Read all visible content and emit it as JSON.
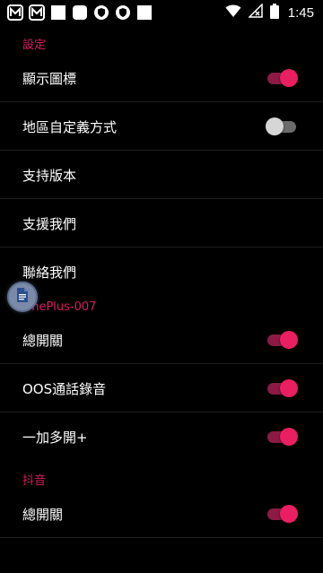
{
  "status_bar": {
    "time": "1:45",
    "left_icons": [
      "mx-app-icon",
      "mx-app-icon",
      "square-icon",
      "rounded-square-icon",
      "shield-icon",
      "shield-icon",
      "square-icon"
    ],
    "right_icons": [
      "wifi-icon",
      "signal-icon",
      "battery-icon"
    ]
  },
  "sections": [
    {
      "header": "設定",
      "items": [
        {
          "label": "顯示圖標",
          "switch": "on"
        },
        {
          "label": "地區自定義方式",
          "switch": "off"
        },
        {
          "label": "支持版本"
        },
        {
          "label": "支援我們"
        },
        {
          "label": "聯絡我們"
        }
      ]
    },
    {
      "header": "OnePlus-007",
      "items": [
        {
          "label": "總開關",
          "switch": "on"
        },
        {
          "label": "OOS通話錄音",
          "switch": "on"
        },
        {
          "label": "一加多開+",
          "switch": "on"
        }
      ]
    },
    {
      "header": "抖音",
      "items": [
        {
          "label": "總開關",
          "switch": "on"
        }
      ]
    }
  ],
  "floating_button": {
    "icon": "document-icon"
  },
  "colors": {
    "accent": "#e91e63",
    "switch_on_track": "#8b1a44",
    "switch_off_thumb": "#d6d6d6",
    "switch_off_track": "#6b6b6b",
    "background": "#000000"
  }
}
